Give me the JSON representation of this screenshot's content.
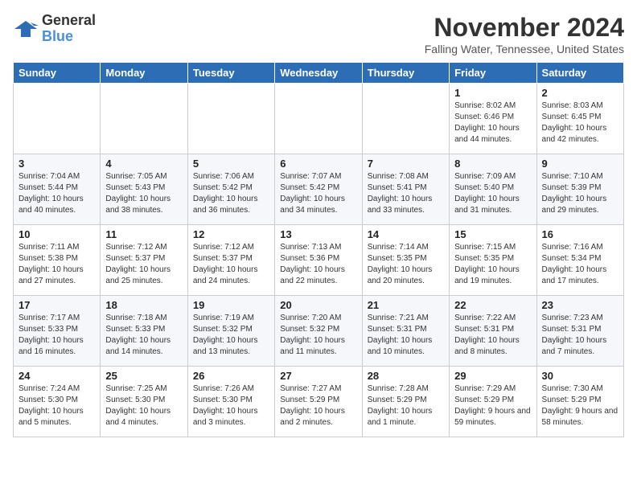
{
  "header": {
    "logo_line1": "General",
    "logo_line2": "Blue",
    "month_year": "November 2024",
    "location": "Falling Water, Tennessee, United States"
  },
  "weekdays": [
    "Sunday",
    "Monday",
    "Tuesday",
    "Wednesday",
    "Thursday",
    "Friday",
    "Saturday"
  ],
  "weeks": [
    [
      {
        "day": "",
        "text": ""
      },
      {
        "day": "",
        "text": ""
      },
      {
        "day": "",
        "text": ""
      },
      {
        "day": "",
        "text": ""
      },
      {
        "day": "",
        "text": ""
      },
      {
        "day": "1",
        "text": "Sunrise: 8:02 AM\nSunset: 6:46 PM\nDaylight: 10 hours and 44 minutes."
      },
      {
        "day": "2",
        "text": "Sunrise: 8:03 AM\nSunset: 6:45 PM\nDaylight: 10 hours and 42 minutes."
      }
    ],
    [
      {
        "day": "3",
        "text": "Sunrise: 7:04 AM\nSunset: 5:44 PM\nDaylight: 10 hours and 40 minutes."
      },
      {
        "day": "4",
        "text": "Sunrise: 7:05 AM\nSunset: 5:43 PM\nDaylight: 10 hours and 38 minutes."
      },
      {
        "day": "5",
        "text": "Sunrise: 7:06 AM\nSunset: 5:42 PM\nDaylight: 10 hours and 36 minutes."
      },
      {
        "day": "6",
        "text": "Sunrise: 7:07 AM\nSunset: 5:42 PM\nDaylight: 10 hours and 34 minutes."
      },
      {
        "day": "7",
        "text": "Sunrise: 7:08 AM\nSunset: 5:41 PM\nDaylight: 10 hours and 33 minutes."
      },
      {
        "day": "8",
        "text": "Sunrise: 7:09 AM\nSunset: 5:40 PM\nDaylight: 10 hours and 31 minutes."
      },
      {
        "day": "9",
        "text": "Sunrise: 7:10 AM\nSunset: 5:39 PM\nDaylight: 10 hours and 29 minutes."
      }
    ],
    [
      {
        "day": "10",
        "text": "Sunrise: 7:11 AM\nSunset: 5:38 PM\nDaylight: 10 hours and 27 minutes."
      },
      {
        "day": "11",
        "text": "Sunrise: 7:12 AM\nSunset: 5:37 PM\nDaylight: 10 hours and 25 minutes."
      },
      {
        "day": "12",
        "text": "Sunrise: 7:12 AM\nSunset: 5:37 PM\nDaylight: 10 hours and 24 minutes."
      },
      {
        "day": "13",
        "text": "Sunrise: 7:13 AM\nSunset: 5:36 PM\nDaylight: 10 hours and 22 minutes."
      },
      {
        "day": "14",
        "text": "Sunrise: 7:14 AM\nSunset: 5:35 PM\nDaylight: 10 hours and 20 minutes."
      },
      {
        "day": "15",
        "text": "Sunrise: 7:15 AM\nSunset: 5:35 PM\nDaylight: 10 hours and 19 minutes."
      },
      {
        "day": "16",
        "text": "Sunrise: 7:16 AM\nSunset: 5:34 PM\nDaylight: 10 hours and 17 minutes."
      }
    ],
    [
      {
        "day": "17",
        "text": "Sunrise: 7:17 AM\nSunset: 5:33 PM\nDaylight: 10 hours and 16 minutes."
      },
      {
        "day": "18",
        "text": "Sunrise: 7:18 AM\nSunset: 5:33 PM\nDaylight: 10 hours and 14 minutes."
      },
      {
        "day": "19",
        "text": "Sunrise: 7:19 AM\nSunset: 5:32 PM\nDaylight: 10 hours and 13 minutes."
      },
      {
        "day": "20",
        "text": "Sunrise: 7:20 AM\nSunset: 5:32 PM\nDaylight: 10 hours and 11 minutes."
      },
      {
        "day": "21",
        "text": "Sunrise: 7:21 AM\nSunset: 5:31 PM\nDaylight: 10 hours and 10 minutes."
      },
      {
        "day": "22",
        "text": "Sunrise: 7:22 AM\nSunset: 5:31 PM\nDaylight: 10 hours and 8 minutes."
      },
      {
        "day": "23",
        "text": "Sunrise: 7:23 AM\nSunset: 5:31 PM\nDaylight: 10 hours and 7 minutes."
      }
    ],
    [
      {
        "day": "24",
        "text": "Sunrise: 7:24 AM\nSunset: 5:30 PM\nDaylight: 10 hours and 5 minutes."
      },
      {
        "day": "25",
        "text": "Sunrise: 7:25 AM\nSunset: 5:30 PM\nDaylight: 10 hours and 4 minutes."
      },
      {
        "day": "26",
        "text": "Sunrise: 7:26 AM\nSunset: 5:30 PM\nDaylight: 10 hours and 3 minutes."
      },
      {
        "day": "27",
        "text": "Sunrise: 7:27 AM\nSunset: 5:29 PM\nDaylight: 10 hours and 2 minutes."
      },
      {
        "day": "28",
        "text": "Sunrise: 7:28 AM\nSunset: 5:29 PM\nDaylight: 10 hours and 1 minute."
      },
      {
        "day": "29",
        "text": "Sunrise: 7:29 AM\nSunset: 5:29 PM\nDaylight: 9 hours and 59 minutes."
      },
      {
        "day": "30",
        "text": "Sunrise: 7:30 AM\nSunset: 5:29 PM\nDaylight: 9 hours and 58 minutes."
      }
    ]
  ]
}
